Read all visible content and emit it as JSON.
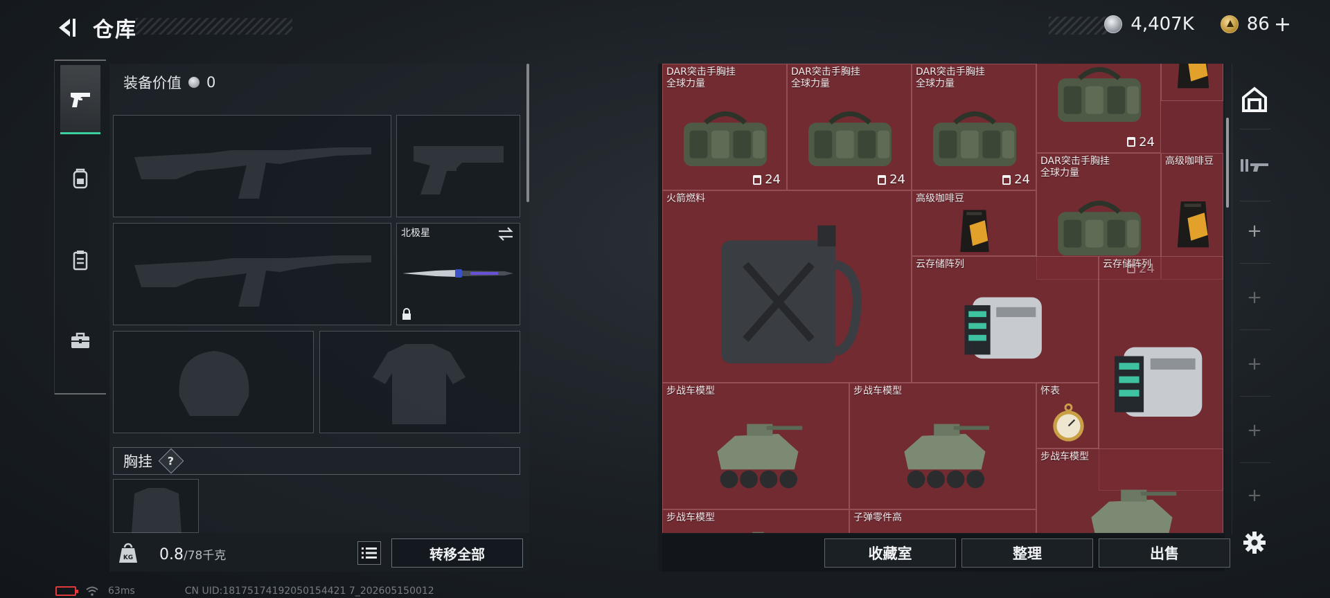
{
  "header": {
    "title": "仓库",
    "currency_main": "4,407K",
    "currency_premium": "86",
    "premium_add": "+"
  },
  "left_rail": {
    "items": [
      {
        "icon": "pistol-icon",
        "active": true
      },
      {
        "icon": "backpack-icon",
        "active": false
      },
      {
        "icon": "chest-rig-icon",
        "active": false
      },
      {
        "icon": "toolbox-icon",
        "active": false
      }
    ]
  },
  "equipment": {
    "value_label": "装备价值",
    "value": "0",
    "knife_name": "北极星",
    "chest_label": "胸挂",
    "chest_help": "?",
    "weight_current": "0.8",
    "weight_capacity": "/78千克",
    "transfer_all": "转移全部"
  },
  "storage": {
    "items": [
      {
        "name": "DAR突击手胸挂\n全球力量",
        "count": "24",
        "kind": "vest"
      },
      {
        "name": "DAR突击手胸挂\n全球力量",
        "count": "24",
        "kind": "vest"
      },
      {
        "name": "DAR突击手胸挂\n全球力量",
        "count": "24",
        "kind": "vest"
      },
      {
        "name": "",
        "count": "24",
        "kind": "vest"
      },
      {
        "name": "",
        "count": "",
        "kind": "coffee"
      },
      {
        "name": "DAR突击手胸挂\n全球力量",
        "count": "24",
        "kind": "vest"
      },
      {
        "name": "高级咖啡豆",
        "count": "",
        "kind": "coffee"
      },
      {
        "name": "火箭燃料",
        "count": "",
        "kind": "jerrycan"
      },
      {
        "name": "高级咖啡豆",
        "count": "",
        "kind": "coffee"
      },
      {
        "name": "云存储阵列",
        "count": "",
        "kind": "server"
      },
      {
        "name": "云存储阵列",
        "count": "",
        "kind": "server"
      },
      {
        "name": "步战车模型",
        "count": "",
        "kind": "ifv"
      },
      {
        "name": "步战车模型",
        "count": "",
        "kind": "ifv"
      },
      {
        "name": "怀表",
        "count": "",
        "kind": "watch"
      },
      {
        "name": "步战车模型",
        "count": "",
        "kind": "ifv"
      },
      {
        "name": "步战车模型",
        "count": "",
        "kind": "ifv"
      },
      {
        "name": "子弹零件高",
        "count": "",
        "kind": "parts"
      }
    ]
  },
  "footer_buttons": {
    "collection": "收藏室",
    "organize": "整理",
    "sell": "出售"
  },
  "status": {
    "ping": "63ms",
    "uid": "CN UID:18175174192050154421 7_202605150012"
  },
  "colors": {
    "accent_green": "#3ad0a0",
    "storage_bg": "#6e2a30",
    "battery_red": "#e03a3a"
  }
}
